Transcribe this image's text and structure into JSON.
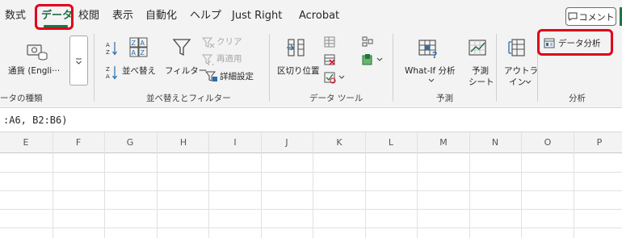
{
  "tabs": [
    {
      "label": "数式"
    },
    {
      "label": "データ",
      "active": true
    },
    {
      "label": "校閲"
    },
    {
      "label": "表示"
    },
    {
      "label": "自動化"
    },
    {
      "label": "ヘルプ"
    },
    {
      "label": "Just Right"
    },
    {
      "label": "Acrobat"
    }
  ],
  "comment_label": "コメント",
  "ribbon": {
    "data_types": {
      "currency_label": "通貨 (Engli···",
      "group_label": "ータの種類"
    },
    "sort_filter": {
      "sort_label": "並べ替え",
      "filter_label": "フィルター",
      "clear_label": "クリア",
      "reapply_label": "再適用",
      "advanced_label": "詳細設定",
      "group_label": "並べ替えとフィルター"
    },
    "data_tools": {
      "text_to_columns_label": "区切り位置",
      "group_label": "データ ツール"
    },
    "forecast": {
      "whatif_label": "What-If 分析",
      "forecast_sheet_label_1": "予測",
      "forecast_sheet_label_2": "シート",
      "group_label": "予測"
    },
    "outline": {
      "label_1": "アウトラ",
      "label_2": "イン"
    },
    "analysis": {
      "data_analysis_label": "データ分析",
      "group_label": "分析"
    }
  },
  "formula_text": ":A6, B2:B6)",
  "columns": [
    "E",
    "F",
    "G",
    "H",
    "I",
    "J",
    "K",
    "L",
    "M",
    "N",
    "O",
    "P"
  ],
  "highlight_color": "#e0001b",
  "accent_color": "#217346"
}
